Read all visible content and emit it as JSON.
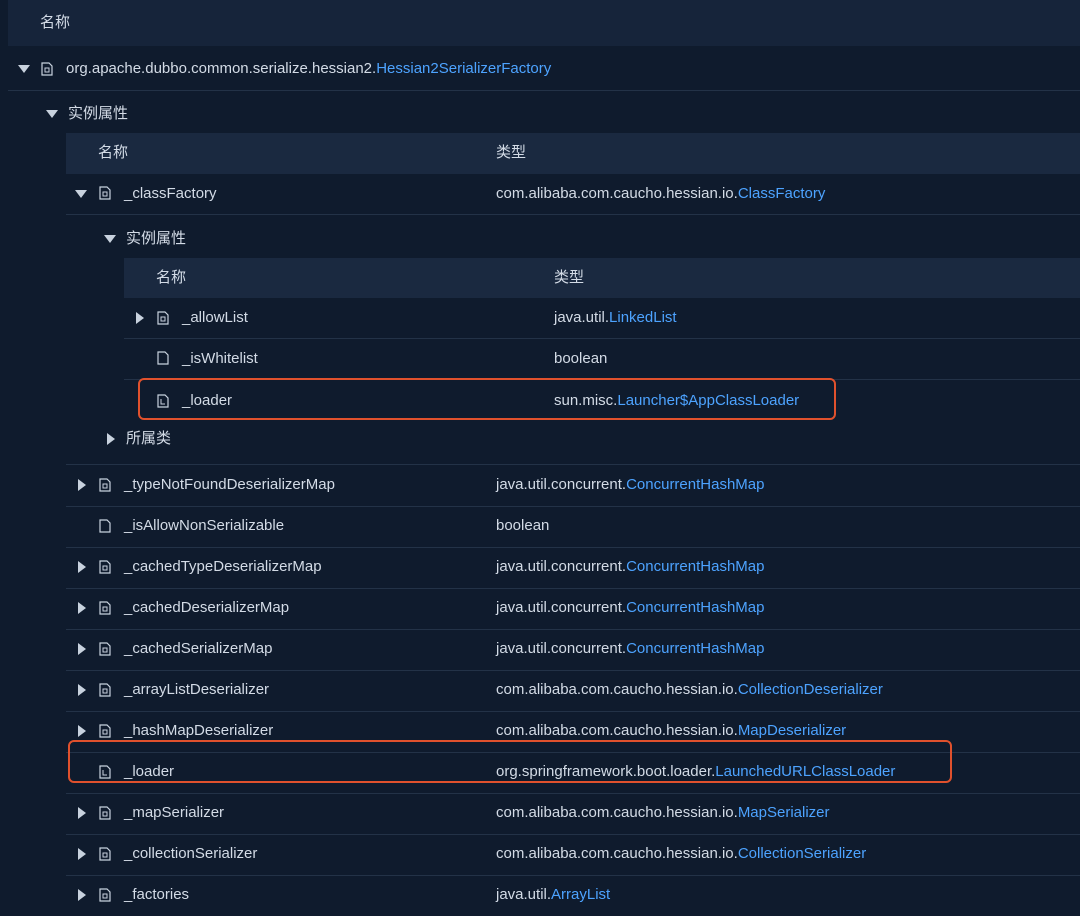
{
  "header": {
    "name_label": "名称"
  },
  "root": {
    "package": "org.apache.dubbo.common.serialize.hessian2.",
    "class": "Hessian2SerializerFactory"
  },
  "instance_section": {
    "label": "实例属性"
  },
  "table": {
    "name_col": "名称",
    "type_col": "类型"
  },
  "class_factory": {
    "name": "_classFactory",
    "type_pkg": "com.alibaba.com.caucho.hessian.io.",
    "type_cls": "ClassFactory"
  },
  "nested_section": {
    "label": "实例属性"
  },
  "nested_table": {
    "name_col": "名称",
    "type_col": "类型"
  },
  "nested_rows": [
    {
      "name": "_allowList",
      "type_pkg": "java.util.",
      "type_cls": "LinkedList"
    },
    {
      "name": "_isWhitelist",
      "type_pkg": "boolean",
      "type_cls": ""
    },
    {
      "name": "_loader",
      "type_pkg": "sun.misc.",
      "type_cls": "Launcher$AppClassLoader"
    }
  ],
  "owner_section": {
    "label": "所属类"
  },
  "rows": [
    {
      "name": "_typeNotFoundDeserializerMap",
      "type_pkg": "java.util.concurrent.",
      "type_cls": "ConcurrentHashMap"
    },
    {
      "name": "_isAllowNonSerializable",
      "type_pkg": "boolean",
      "type_cls": ""
    },
    {
      "name": "_cachedTypeDeserializerMap",
      "type_pkg": "java.util.concurrent.",
      "type_cls": "ConcurrentHashMap"
    },
    {
      "name": "_cachedDeserializerMap",
      "type_pkg": "java.util.concurrent.",
      "type_cls": "ConcurrentHashMap"
    },
    {
      "name": "_cachedSerializerMap",
      "type_pkg": "java.util.concurrent.",
      "type_cls": "ConcurrentHashMap"
    },
    {
      "name": "_arrayListDeserializer",
      "type_pkg": "com.alibaba.com.caucho.hessian.io.",
      "type_cls": "CollectionDeserializer"
    },
    {
      "name": "_hashMapDeserializer",
      "type_pkg": "com.alibaba.com.caucho.hessian.io.",
      "type_cls": "MapDeserializer"
    },
    {
      "name": "_loader",
      "type_pkg": "org.springframework.boot.loader.",
      "type_cls": "LaunchedURLClassLoader"
    },
    {
      "name": "_mapSerializer",
      "type_pkg": "com.alibaba.com.caucho.hessian.io.",
      "type_cls": "MapSerializer"
    },
    {
      "name": "_collectionSerializer",
      "type_pkg": "com.alibaba.com.caucho.hessian.io.",
      "type_cls": "CollectionSerializer"
    },
    {
      "name": "_factories",
      "type_pkg": "java.util.",
      "type_cls": "ArrayList"
    }
  ],
  "colors": {
    "background": "#0f1b2d",
    "header": "#16243a",
    "link": "#4da3ff",
    "highlight": "#e0512d"
  }
}
